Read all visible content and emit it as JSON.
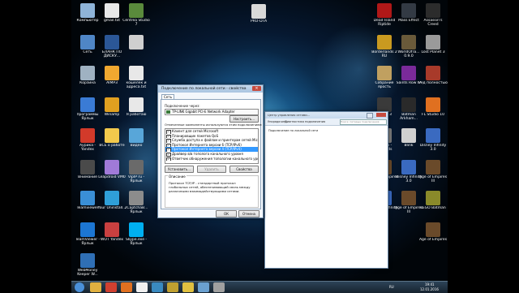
{
  "desktop": {
    "left_icons": [
      {
        "label": "Компьютер",
        "color": "#8fb4d8"
      },
      {
        "label": "gmail.txt",
        "color": "#e8e8e8"
      },
      {
        "label": "Centrea Studio 7",
        "color": "#5a8a3c"
      },
      {
        "label": "Сеть",
        "color": "#4f86c6"
      },
      {
        "label": "БЛАНК ПО ДИСКУ...",
        "color": "#2b5797"
      },
      {
        "label": "",
        "color": "#cfcfcf"
      },
      {
        "label": "Корзина",
        "color": "#9fb2c2"
      },
      {
        "label": "AIMP3",
        "color": "#f0a830"
      },
      {
        "label": "кошелек и адреса.txt",
        "color": "#e8e8e8"
      },
      {
        "label": "программы Ярлык",
        "color": "#3a7bd5"
      },
      {
        "label": "Winamp",
        "color": "#e0a020"
      },
      {
        "label": "Я работаю",
        "color": "#e8e8e8"
      },
      {
        "label": "Аурика - Yandex",
        "color": "#d23a2a"
      },
      {
        "label": "ВСЕ о работе",
        "color": "#f2c94c"
      },
      {
        "label": "Видео",
        "color": "#58a6d9"
      },
      {
        "label": "Внимание",
        "color": "#4a4a4a"
      },
      {
        "label": "Leapdroid VM0",
        "color": "#a07ad8"
      },
      {
        "label": "VipIP ru - Ярлык",
        "color": "#6a6a6a"
      },
      {
        "label": "Teamviewer",
        "color": "#3a8fd6"
      },
      {
        "label": "Your Uninstall...",
        "color": "#2f9fd8"
      },
      {
        "label": "2CaptchaB... Ярлык",
        "color": "#8c8c8c"
      },
      {
        "label": "TeamViewer - Ярлык",
        "color": "#1c76d2"
      },
      {
        "label": "WOT Yandex",
        "color": "#c94040"
      },
      {
        "label": "Skype.exe - Ярлык",
        "color": "#00aff0"
      },
      {
        "label": "WebMoney Keeper W...",
        "color": "#2f6fb5"
      }
    ],
    "center_icon": {
      "label": "PRO-DTA",
      "color": "#d8d8d8"
    },
    "right_icons": [
      {
        "label": "Dead Island Riptide",
        "color": "#b01818"
      },
      {
        "label": "Mass Effect",
        "color": "#333a44"
      },
      {
        "label": "Assassin's Creed",
        "color": "#2c2c2c"
      },
      {
        "label": "Borderlands 2 RU",
        "color": "#c99a20"
      },
      {
        "label": "WorldOfTa... 0.9.0",
        "color": "#6a5a3a"
      },
      {
        "label": "Lost Planet 3",
        "color": "#9a9a9a"
      },
      {
        "label": "Собрание ярость",
        "color": "#c0a060"
      },
      {
        "label": "Saints Row IV",
        "color": "#7a2a9a"
      },
      {
        "label": "Ред полностью",
        "color": "#a83a2a"
      },
      {
        "label": "Crysis 3",
        "color": "#3a3a3a"
      },
      {
        "label": "Batman Arkham...",
        "color": "#2a2a2a"
      },
      {
        "label": "FL Studio 10",
        "color": "#e07020"
      },
      {
        "label": "Skyrim - Legends",
        "color": "#7a7a7a"
      },
      {
        "label": "Blink",
        "color": "#d0d0d0"
      },
      {
        "label": "Disney Infinity 3.0",
        "color": "#3a6ac0"
      },
      {
        "label": "Age of Empires III",
        "color": "#6a4a2a"
      },
      {
        "label": "Disney Infinity 3.0",
        "color": "#3a6ac0"
      },
      {
        "label": "Age of Empires III",
        "color": "#6a4a2a"
      },
      {
        "label": "Disney Infinity 3.0",
        "color": "#3a6ac0"
      },
      {
        "label": "Age of Empires III",
        "color": "#6a4a2a"
      },
      {
        "label": "LEGO Batman",
        "color": "#8a8a2a"
      },
      {
        "label": "Age of Empires",
        "color": "#6a4a2a"
      }
    ]
  },
  "explorer": {
    "breadcrumb": "Центр управления сетями...",
    "search_placeholder": "Поиск: Сетевые подключения",
    "toolbar": [
      "Упорядочить",
      "Диагностика подключения",
      "Переименование подключения"
    ],
    "content_label": "Подключение по локальной сети"
  },
  "dialog": {
    "title": "Подключение по локальной сети - свойства",
    "tab": "Сеть",
    "connect_through_label": "Подключение через:",
    "adapter": "TP-LINK Gigabit PCI-E Network Adapter",
    "configure_button": "Настроить...",
    "components_label": "Отмеченные компоненты используются этим подключением:",
    "components": [
      {
        "label": "Клиент для сетей Microsoft",
        "checked": true,
        "selected": false
      },
      {
        "label": "Планировщик пакетов QoS",
        "checked": true,
        "selected": false
      },
      {
        "label": "Служба доступа к файлам и принтерам сетей Micro...",
        "checked": true,
        "selected": false
      },
      {
        "label": "Протокол Интернета версии 6 (TCP/IPv6)",
        "checked": true,
        "selected": false
      },
      {
        "label": "Протокол Интернета версии 4 (TCP/IPv4)",
        "checked": true,
        "selected": true
      },
      {
        "label": "Драйвер в/в тополога канального уровня",
        "checked": true,
        "selected": false
      },
      {
        "label": "Ответчик обнаружения топологии канального уровня",
        "checked": true,
        "selected": false
      }
    ],
    "install_button": "Установить...",
    "remove_button": "Удалить",
    "properties_button": "Свойства",
    "description_title": "Описание",
    "description_text": "Протокол TCP/IP - стандартный протокол глобальных сетей, обеспечивающий связь между различными взаимодействующими сетями.",
    "ok_button": "ОК",
    "cancel_button": "Отмена"
  },
  "taskbar": {
    "items": [
      {
        "name": "start",
        "color": "#4a90d9"
      },
      {
        "name": "explorer",
        "color": "#e0b040"
      },
      {
        "name": "chrome",
        "color": "#d04030"
      },
      {
        "name": "firefox",
        "color": "#e07020"
      },
      {
        "name": "yandex",
        "color": "#f0f0f0"
      },
      {
        "name": "media",
        "color": "#3a8ac0"
      },
      {
        "name": "task-a",
        "color": "#c0a030"
      },
      {
        "name": "task-b",
        "color": "#e0c040"
      },
      {
        "name": "task-c",
        "color": "#6aa0d0"
      },
      {
        "name": "task-d",
        "color": "#a0a0a0"
      }
    ],
    "tray_lang": "RU",
    "clock_time": "19:41",
    "clock_date": "12.01.2016"
  }
}
